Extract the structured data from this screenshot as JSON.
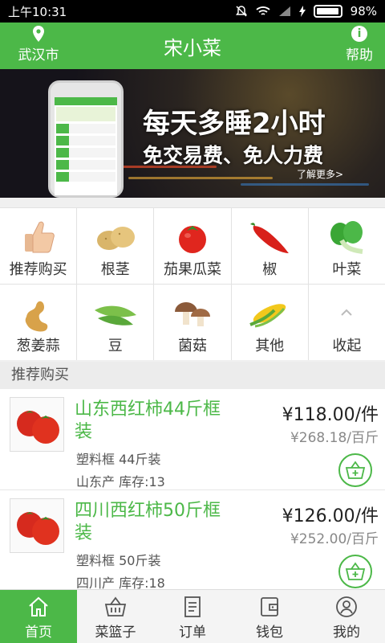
{
  "status": {
    "time": "上午10:31",
    "battery": "98%",
    "battery_level": 0.98
  },
  "header": {
    "city": "武汉市",
    "title": "宋小菜",
    "help": "帮助"
  },
  "banner": {
    "headline": "每天多睡2小时",
    "subline": "免交易费、免人力费",
    "more": "了解更多>"
  },
  "categories": [
    {
      "label": "推荐购买",
      "icon": "thumbs-up-icon"
    },
    {
      "label": "根茎",
      "icon": "potato-icon"
    },
    {
      "label": "茄果瓜菜",
      "icon": "tomato-icon"
    },
    {
      "label": "椒",
      "icon": "chili-pepper-icon"
    },
    {
      "label": "叶菜",
      "icon": "bok-choy-icon"
    },
    {
      "label": "葱姜蒜",
      "icon": "ginger-icon"
    },
    {
      "label": "豆",
      "icon": "pea-pod-icon"
    },
    {
      "label": "菌菇",
      "icon": "mushroom-icon"
    },
    {
      "label": "其他",
      "icon": "corn-icon"
    },
    {
      "label": "收起",
      "icon": "chevron-up-icon"
    }
  ],
  "section_title": "推荐购买",
  "products": [
    {
      "name": "山东西红柿44斤框装",
      "spec": "塑料框 44斤装",
      "origin": "山东产 库存:13",
      "price": "¥118.00/件",
      "unit_price": "¥268.18/百斤"
    },
    {
      "name": "四川西红柿50斤框装",
      "spec": "塑料框 50斤装",
      "origin": "四川产 库存:18",
      "price": "¥126.00/件",
      "unit_price": "¥252.00/百斤"
    }
  ],
  "tabs": [
    {
      "label": "首页",
      "icon": "home-icon",
      "active": true
    },
    {
      "label": "菜篮子",
      "icon": "basket-icon",
      "active": false
    },
    {
      "label": "订单",
      "icon": "order-list-icon",
      "active": false
    },
    {
      "label": "钱包",
      "icon": "wallet-icon",
      "active": false
    },
    {
      "label": "我的",
      "icon": "user-icon",
      "active": false
    }
  ],
  "colors": {
    "brand": "#4cb848"
  }
}
